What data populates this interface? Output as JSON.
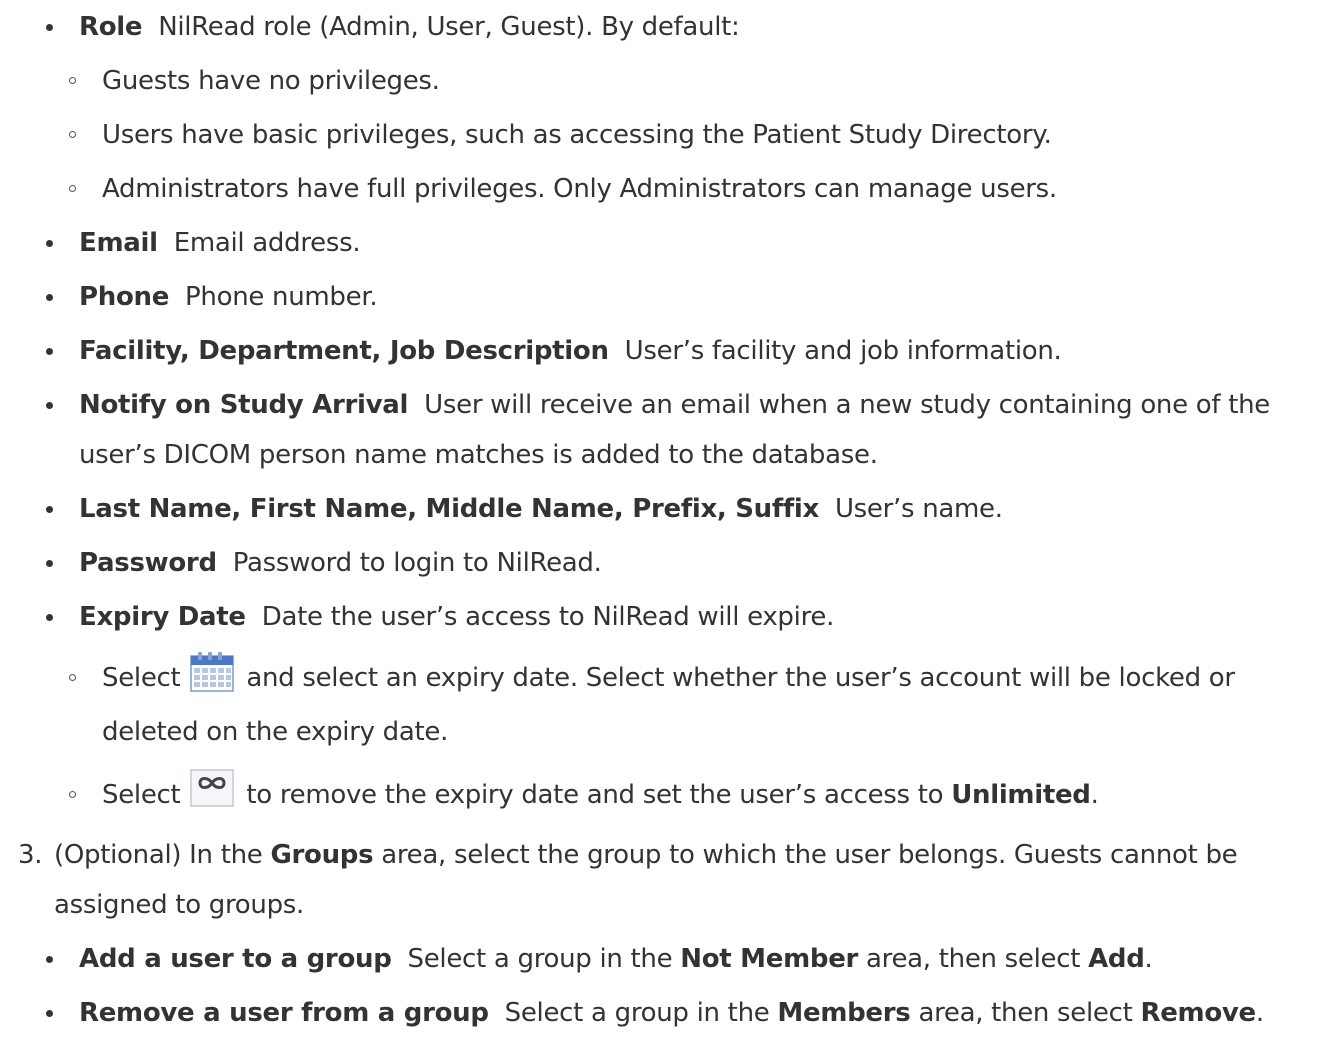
{
  "colors": {
    "text": "#333333",
    "icon_blue": "#4a7ac6",
    "icon_grid": "#b8c8e2"
  },
  "items": {
    "role": {
      "term": "Role",
      "desc": "NilRead role (Admin, User, Guest). By default:"
    },
    "role_sub1": "Guests have no privileges.",
    "role_sub2": "Users have basic privileges, such as accessing the Patient Study Directory.",
    "role_sub3": "Administrators have full privileges. Only Administrators can manage users.",
    "email": {
      "term": "Email",
      "desc": "Email address."
    },
    "phone": {
      "term": "Phone",
      "desc": "Phone number."
    },
    "facility": {
      "term": "Facility, Department, Job Description",
      "desc": "User’s facility and job information."
    },
    "notify": {
      "term": "Notify on Study Arrival",
      "desc1": "User will receive an email when a new study containing one of the",
      "desc2": "user’s DICOM person name matches is added to the database."
    },
    "name": {
      "term": "Last Name, First Name, Middle Name, Prefix, Suffix",
      "desc": "User’s name."
    },
    "password": {
      "term": "Password",
      "desc": "Password to login to NilRead."
    },
    "expiry": {
      "term": "Expiry Date",
      "desc": "Date the user’s access to NilRead will expire."
    },
    "expiry_sub1": {
      "pre": "Select",
      "post": "and select an expiry date. Select whether the user’s account will be locked or",
      "line2": "deleted on the expiry date.",
      "icon": "calendar-icon"
    },
    "expiry_sub2": {
      "pre": "Select",
      "post": "to remove the expiry date and set the user’s access to",
      "bold": "Unlimited",
      "end": ".",
      "icon": "infinity-icon"
    }
  },
  "step3": {
    "number": "3.",
    "pre": "(Optional) In the",
    "bold": "Groups",
    "post": "area, select the group to which the user belongs. Guests cannot be",
    "line2": "assigned to groups.",
    "add": {
      "term": "Add a user to a group",
      "pre": "Select a group in the",
      "bold1": "Not Member",
      "mid": "area, then select",
      "bold2": "Add",
      "end": "."
    },
    "remove": {
      "term": "Remove a user from a group",
      "pre": "Select a group in the",
      "bold1": "Members",
      "mid": "area, then select",
      "bold2": "Remove",
      "end": "."
    }
  }
}
